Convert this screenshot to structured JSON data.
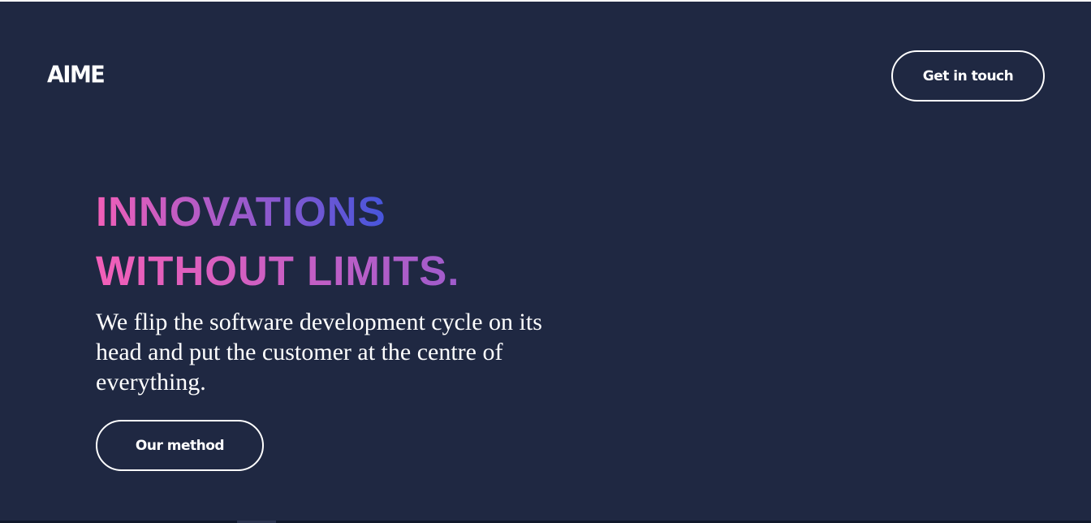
{
  "header": {
    "logo_text": "AIME",
    "contact_button_label": "Get in touch"
  },
  "hero": {
    "headline_line1": "INNOVATIONS",
    "headline_line2": "WITHOUT LIMITS.",
    "subtitle": "We flip the software development cycle on its head and put the customer at the centre of everything.",
    "cta_label": "Our method"
  },
  "colors": {
    "background": "#1f2842",
    "text": "#ffffff",
    "gradient_pink": "#f25fb8",
    "gradient_purple": "#a55ac9",
    "gradient_blue": "#4655dc"
  }
}
